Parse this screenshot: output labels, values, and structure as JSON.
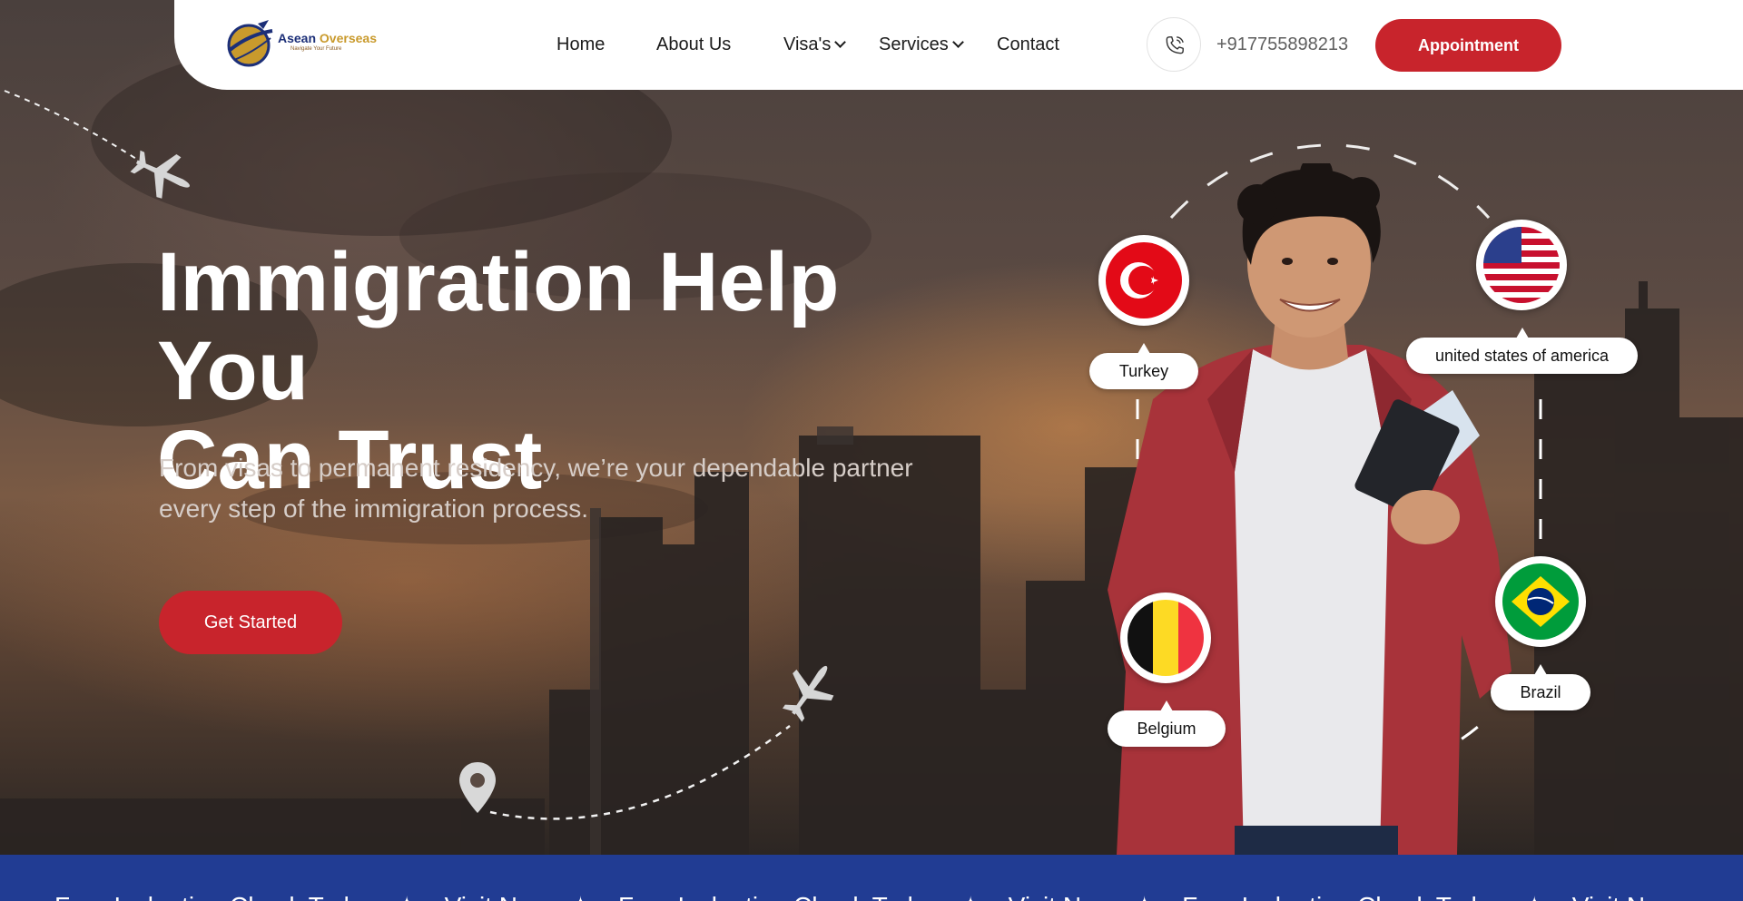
{
  "brand": {
    "name_part1": "Asean",
    "name_part2": "Overseas",
    "tagline": "Navigate Your Future"
  },
  "nav": {
    "items": [
      {
        "label": "Home"
      },
      {
        "label": "About Us"
      },
      {
        "label": "Visa's",
        "has_dropdown": true
      },
      {
        "label": "Services",
        "has_dropdown": true
      },
      {
        "label": "Contact"
      }
    ]
  },
  "header": {
    "phone_icon": "phone-icon",
    "phone_number": "+917755898213",
    "appointment_label": "Appointment"
  },
  "hero": {
    "title_line1": "Immigration Help You",
    "title_line2": "Can Trust",
    "subtitle_line1": "From visas to permanent residency, we’re your dependable partner",
    "subtitle_line2": "every step of the immigration process.",
    "cta_label": "Get Started"
  },
  "countries": [
    {
      "name": "Turkey",
      "flag_icon": "turkey-flag-icon"
    },
    {
      "name": "united states of america",
      "flag_icon": "usa-flag-icon"
    },
    {
      "name": "Belgium",
      "flag_icon": "belgium-flag-icon"
    },
    {
      "name": "Brazil",
      "flag_icon": "brazil-flag-icon"
    }
  ],
  "ticker": {
    "items": [
      "Free Ivaluation Check Today",
      "Visit Now",
      "Free Ivaluation Check Today",
      "Visit Now",
      "Free Ivaluation Check Today",
      "Visit Now"
    ]
  },
  "colors": {
    "accent_red": "#c8242c",
    "band_blue": "#213c93",
    "header_bg": "#ffffff"
  }
}
